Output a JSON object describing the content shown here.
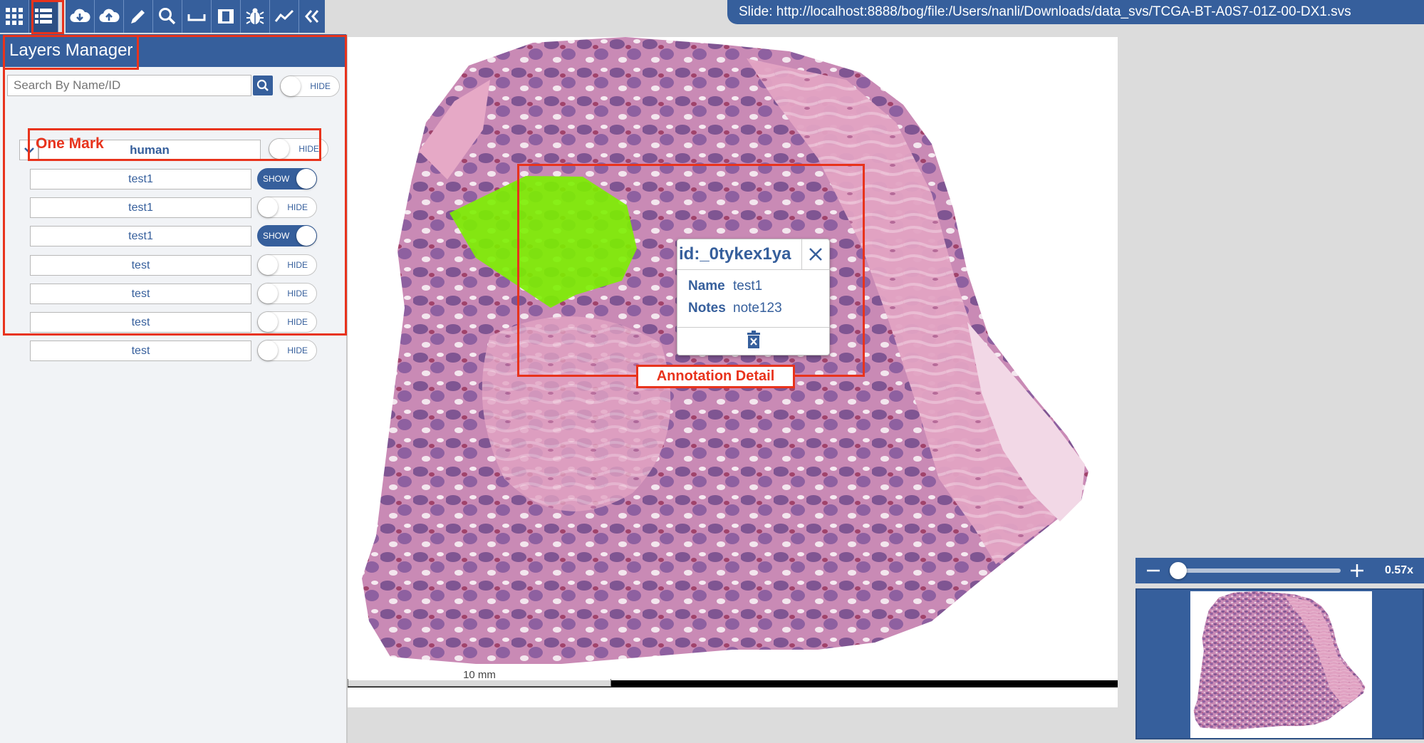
{
  "toolbar": {
    "buttons": [
      {
        "name": "apps-icon",
        "active": false
      },
      {
        "name": "layers-list-icon",
        "active": true
      },
      {
        "name": "cloud-download-icon",
        "active": false
      },
      {
        "name": "cloud-upload-icon",
        "active": false
      },
      {
        "name": "pencil-icon",
        "active": false
      },
      {
        "name": "magnifier-icon",
        "active": false
      },
      {
        "name": "ruler-icon",
        "active": false
      },
      {
        "name": "film-icon",
        "active": false
      },
      {
        "name": "bug-icon",
        "active": false
      },
      {
        "name": "line-chart-icon",
        "active": false
      },
      {
        "name": "double-chevron-left-icon",
        "active": false
      }
    ]
  },
  "slide": {
    "title": "Slide: http://localhost:8888/bog/file:/Users/nanli/Downloads/data_svs/TCGA-BT-A0S7-01Z-00-DX1.svs"
  },
  "layers_manager": {
    "title": "Layers Manager",
    "search": {
      "placeholder": "Search By Name/ID",
      "value": ""
    },
    "search_toggle": {
      "label": "HIDE",
      "on": false
    },
    "group": {
      "name": "human",
      "toggle_label": "HIDE",
      "on": false,
      "chevron_icon": "chevron-down-icon"
    },
    "items": [
      {
        "label": "test1",
        "toggle": "SHOW",
        "on": true
      },
      {
        "label": "test1",
        "toggle": "HIDE",
        "on": false
      },
      {
        "label": "test1",
        "toggle": "SHOW",
        "on": true
      },
      {
        "label": "test",
        "toggle": "HIDE",
        "on": false
      },
      {
        "label": "test",
        "toggle": "HIDE",
        "on": false
      },
      {
        "label": "test",
        "toggle": "HIDE",
        "on": false
      },
      {
        "label": "test",
        "toggle": "HIDE",
        "on": false
      }
    ]
  },
  "callouts": {
    "one_mark": "One Mark",
    "annotation_detail": "Annotation Detail"
  },
  "viewer": {
    "scale_label": "10 mm"
  },
  "popup": {
    "title": "id:_0tykex1ya",
    "name_key": "Name",
    "name_value": "test1",
    "notes_key": "Notes",
    "notes_value": "note123",
    "close_icon": "close-icon",
    "delete_icon": "trash-icon"
  },
  "zoom": {
    "level_label": "0.57x",
    "level_fraction": 0.0
  },
  "colors": {
    "primary": "#365f9c",
    "callout_red": "#e8331c",
    "annotation_green": "#7cf000",
    "tissue_pink": "#dd8fb4",
    "tissue_purple": "#8b5a9e"
  }
}
